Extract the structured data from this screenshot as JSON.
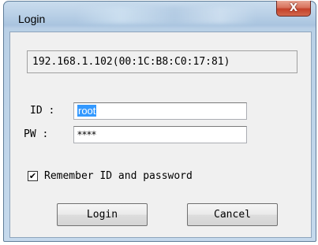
{
  "window": {
    "title": "Login",
    "close_label": "X"
  },
  "server_info": "192.168.1.102(00:1C:B8:C0:17:81)",
  "form": {
    "id_label": "ID :",
    "id_value": "root",
    "pw_label": "PW :",
    "pw_value": "****",
    "remember_label": "Remember ID and password",
    "remember_checked": true
  },
  "buttons": {
    "login": "Login",
    "cancel": "Cancel"
  },
  "icons": {
    "check": "check-mark-icon"
  }
}
